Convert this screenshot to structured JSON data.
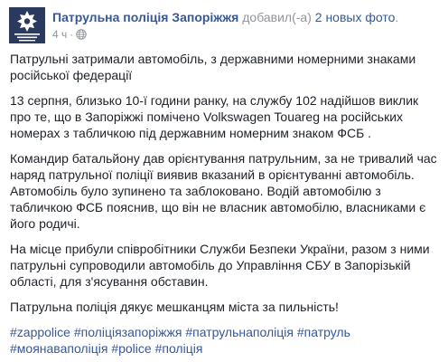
{
  "header": {
    "author": "Патрульна поліція Запоріжжя",
    "action": " добавил(-а) ",
    "photos_link": "2 новых фото",
    "period": ".",
    "time": "4 ч",
    "separator": "·",
    "avatar_text": "ПАТРУЛЬНА ПОЛІЦІЯ ЗАПОРІЖЖЯ",
    "avatar_color": "#2a3a5e"
  },
  "post": {
    "paragraphs": [
      "Патрульні затримали автомобіль, з державними номерними знаками російської федерації",
      "13 серпня, близько 10-ї години ранку, на службу 102 надійшов виклик про те, що в Запоріжжі помічено Volkswagen Touareg на російських номерах з табличкою під державним номерним знаком ФСБ .",
      "Командир батальйону дав орієнтування патрульним, за не тривалий час наряд патрульної поліції виявив вказаний в орієнтуванні автомобіль. Автомобіль було зупинено та заблоковано. Водій автомобілю з табличкою ФСБ пояснив, що він не власник автомобілю, власниками є його родичі.",
      "На місце прибули співробітники Служби Безпеки України, разом з ними патрульні супроводили автомобіль до Управління СБУ в Запорізькій області, для з'ясування обставин.",
      "Патрульна поліція дякує мешканцям міста за пильність!"
    ],
    "hashtags": [
      "#zappolice",
      "#поліціязапоріжжя",
      "#патрульнаполіція",
      "#патруль",
      "#моянаваполіція",
      "#police",
      "#поліція"
    ]
  },
  "colors": {
    "link": "#365899",
    "text": "#1d2129",
    "meta": "#90949c"
  }
}
